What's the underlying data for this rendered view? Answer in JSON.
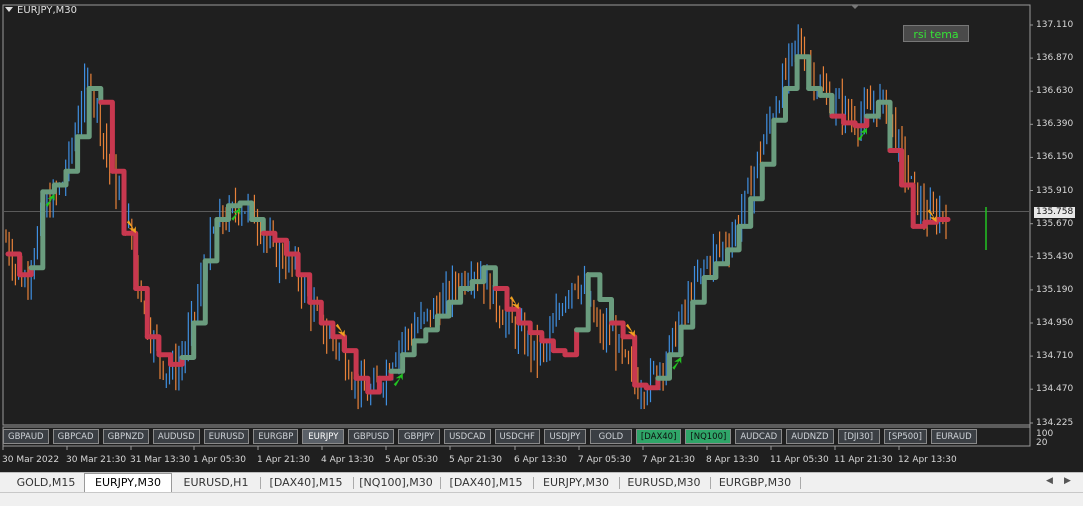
{
  "window": {
    "title": "EURJPY,M30"
  },
  "indicator_button": {
    "label": "rsi tema",
    "text_color": "#35e335"
  },
  "current_price": "135.758",
  "price_axis": [
    "137.110",
    "136.870",
    "136.630",
    "136.390",
    "136.150",
    "135.910",
    "135.670",
    "135.430",
    "135.190",
    "134.950",
    "134.710",
    "134.470",
    "134.225"
  ],
  "subwindow_levels": [
    "100",
    "20"
  ],
  "time_axis": [
    "30 Mar 2022",
    "30 Mar 21:30",
    "31 Mar 13:30",
    "1 Apr 05:30",
    "1 Apr 21:30",
    "4 Apr 13:30",
    "5 Apr 05:30",
    "5 Apr 21:30",
    "6 Apr 13:30",
    "7 Apr 05:30",
    "7 Apr 21:30",
    "8 Apr 13:30",
    "11 Apr 05:30",
    "11 Apr 21:30",
    "12 Apr 13:30"
  ],
  "symbol_buttons": [
    {
      "label": "GBPAUD",
      "state": "normal"
    },
    {
      "label": "GBPCAD",
      "state": "normal"
    },
    {
      "label": "GBPNZD",
      "state": "normal"
    },
    {
      "label": "AUDUSD",
      "state": "normal"
    },
    {
      "label": "EURUSD",
      "state": "normal"
    },
    {
      "label": "EURGBP",
      "state": "normal"
    },
    {
      "label": "EURJPY",
      "state": "active"
    },
    {
      "label": "GBPUSD",
      "state": "normal"
    },
    {
      "label": "GBPJPY",
      "state": "normal"
    },
    {
      "label": "USDCAD",
      "state": "normal"
    },
    {
      "label": "USDCHF",
      "state": "normal"
    },
    {
      "label": "USDJPY",
      "state": "normal"
    },
    {
      "label": "GOLD",
      "state": "normal"
    },
    {
      "label": "[DAX40]",
      "state": "green"
    },
    {
      "label": "[NQ100]",
      "state": "green"
    },
    {
      "label": "AUDCAD",
      "state": "normal"
    },
    {
      "label": "AUDNZD",
      "state": "normal"
    },
    {
      "label": "[DJI30]",
      "state": "normal"
    },
    {
      "label": "[SP500]",
      "state": "normal"
    },
    {
      "label": "EURAUD",
      "state": "normal"
    }
  ],
  "chart_tabs": [
    {
      "label": "GOLD,M15",
      "active": false
    },
    {
      "label": "EURJPY,M30",
      "active": true
    },
    {
      "label": "EURUSD,H1",
      "active": false
    },
    {
      "label": "[DAX40],M15",
      "active": false
    },
    {
      "label": "[NQ100],M30",
      "active": false
    },
    {
      "label": "[DAX40],M15",
      "active": false
    },
    {
      "label": "EURJPY,M30",
      "active": false
    },
    {
      "label": "EURUSD,M30",
      "active": false
    },
    {
      "label": "EURGBP,M30",
      "active": false
    }
  ],
  "colors": {
    "background": "#1f1f1f",
    "bull_candle": "#3f8fe0",
    "bear_candle": "#e8823a",
    "trend_up": "#6a9c7e",
    "trend_down": "#c8384f",
    "buy_arrow": "#22c322",
    "sell_arrow": "#f0a020"
  },
  "chart_data": {
    "type": "line",
    "symbol": "EURJPY",
    "timeframe": "M30",
    "y_range": [
      134.225,
      137.11
    ],
    "last_price": 135.758,
    "x": [
      "30 Mar 2022",
      "30 Mar 21:30",
      "31 Mar 13:30",
      "1 Apr 05:30",
      "1 Apr 21:30",
      "4 Apr 13:30",
      "5 Apr 05:30",
      "5 Apr 21:30",
      "6 Apr 13:30",
      "7 Apr 05:30",
      "7 Apr 21:30",
      "8 Apr 13:30",
      "11 Apr 05:30",
      "11 Apr 21:30",
      "12 Apr 13:30"
    ],
    "price_path": [
      135.55,
      135.35,
      135.25,
      135.48,
      135.75,
      135.85,
      135.95,
      136.2,
      136.55,
      136.7,
      136.45,
      136.1,
      135.9,
      135.7,
      135.35,
      135.0,
      134.78,
      134.62,
      134.6,
      134.7,
      134.95,
      135.25,
      135.55,
      135.7,
      135.72,
      135.8,
      135.78,
      135.7,
      135.55,
      135.45,
      135.42,
      135.35,
      135.2,
      135.05,
      134.9,
      134.83,
      134.75,
      134.62,
      134.48,
      134.42,
      134.5,
      134.62,
      134.78,
      134.85,
      134.92,
      134.98,
      135.05,
      135.1,
      135.2,
      135.25,
      135.35,
      135.3,
      135.18,
      135.05,
      134.95,
      134.88,
      134.8,
      134.72,
      134.75,
      134.95,
      135.15,
      135.28,
      135.2,
      135.0,
      134.85,
      134.92,
      134.72,
      134.6,
      134.48,
      134.52,
      134.62,
      134.72,
      134.88,
      135.05,
      135.2,
      135.35,
      135.45,
      135.5,
      135.58,
      135.75,
      135.95,
      136.2,
      136.4,
      136.6,
      136.8,
      137.0,
      136.85,
      136.7,
      136.6,
      136.55,
      136.5,
      136.42,
      136.45,
      136.5,
      136.55,
      136.45,
      136.2,
      136.0,
      135.82,
      135.72,
      135.73,
      135.76
    ],
    "trend_steps": [
      [
        135.45,
        "down"
      ],
      [
        135.3,
        "down"
      ],
      [
        135.35,
        "up"
      ],
      [
        135.9,
        "up"
      ],
      [
        135.95,
        "up"
      ],
      [
        136.05,
        "up"
      ],
      [
        136.3,
        "up"
      ],
      [
        136.65,
        "up"
      ],
      [
        136.55,
        "down"
      ],
      [
        136.05,
        "down"
      ],
      [
        135.6,
        "down"
      ],
      [
        135.2,
        "down"
      ],
      [
        134.85,
        "down"
      ],
      [
        134.72,
        "down"
      ],
      [
        134.65,
        "down"
      ],
      [
        134.7,
        "up"
      ],
      [
        134.95,
        "up"
      ],
      [
        135.4,
        "up"
      ],
      [
        135.7,
        "up"
      ],
      [
        135.8,
        "up"
      ],
      [
        135.82,
        "up"
      ],
      [
        135.7,
        "up"
      ],
      [
        135.6,
        "down"
      ],
      [
        135.55,
        "down"
      ],
      [
        135.45,
        "down"
      ],
      [
        135.3,
        "down"
      ],
      [
        135.1,
        "down"
      ],
      [
        134.95,
        "down"
      ],
      [
        134.85,
        "down"
      ],
      [
        134.75,
        "down"
      ],
      [
        134.55,
        "down"
      ],
      [
        134.45,
        "down"
      ],
      [
        134.55,
        "down"
      ],
      [
        134.6,
        "up"
      ],
      [
        134.72,
        "up"
      ],
      [
        134.82,
        "up"
      ],
      [
        134.9,
        "up"
      ],
      [
        135.0,
        "up"
      ],
      [
        135.1,
        "up"
      ],
      [
        135.2,
        "up"
      ],
      [
        135.25,
        "up"
      ],
      [
        135.35,
        "up"
      ],
      [
        135.2,
        "down"
      ],
      [
        135.05,
        "down"
      ],
      [
        134.95,
        "down"
      ],
      [
        134.88,
        "down"
      ],
      [
        134.82,
        "down"
      ],
      [
        134.75,
        "down"
      ],
      [
        134.72,
        "down"
      ],
      [
        134.9,
        "up"
      ],
      [
        135.3,
        "up"
      ],
      [
        135.12,
        "up"
      ],
      [
        134.95,
        "down"
      ],
      [
        134.85,
        "down"
      ],
      [
        134.5,
        "down"
      ],
      [
        134.48,
        "down"
      ],
      [
        134.55,
        "up"
      ],
      [
        134.72,
        "up"
      ],
      [
        134.92,
        "up"
      ],
      [
        135.1,
        "up"
      ],
      [
        135.28,
        "up"
      ],
      [
        135.38,
        "up"
      ],
      [
        135.48,
        "up"
      ],
      [
        135.65,
        "up"
      ],
      [
        135.85,
        "up"
      ],
      [
        136.1,
        "up"
      ],
      [
        136.42,
        "up"
      ],
      [
        136.65,
        "up"
      ],
      [
        136.88,
        "up"
      ],
      [
        136.65,
        "up"
      ],
      [
        136.6,
        "up"
      ],
      [
        136.45,
        "down"
      ],
      [
        136.4,
        "down"
      ],
      [
        136.38,
        "down"
      ],
      [
        136.45,
        "up"
      ],
      [
        136.55,
        "up"
      ],
      [
        136.2,
        "down"
      ],
      [
        135.95,
        "down"
      ],
      [
        135.65,
        "down"
      ],
      [
        135.68,
        "down"
      ],
      [
        135.7,
        "down"
      ]
    ],
    "buy_signals": [
      3,
      19,
      33,
      57,
      73
    ],
    "sell_signals": [
      10,
      28,
      43,
      53,
      79
    ],
    "grid": false
  }
}
